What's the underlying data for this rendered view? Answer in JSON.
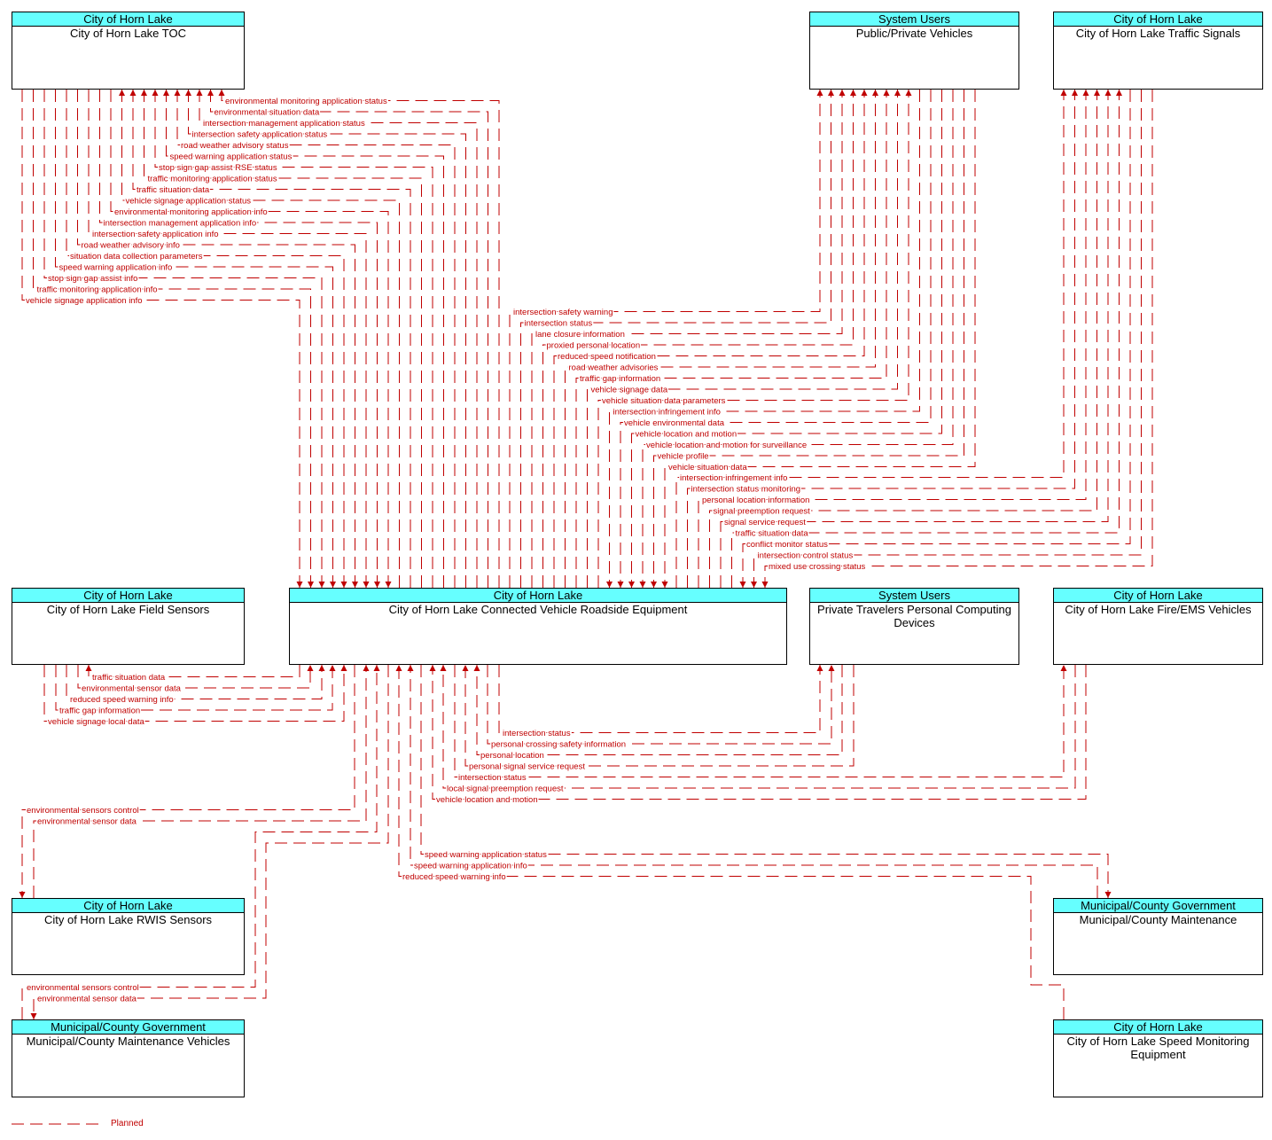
{
  "colors": {
    "flow": "#c00000",
    "header": "#66ffff",
    "border": "#000000"
  },
  "boxes": [
    {
      "id": "toc",
      "category": "City of Horn Lake",
      "name": "City of Horn Lake TOC"
    },
    {
      "id": "ppv",
      "category": "System Users",
      "name": "Public/Private Vehicles"
    },
    {
      "id": "ts",
      "category": "City of Horn Lake",
      "name": "City of Horn Lake Traffic Signals"
    },
    {
      "id": "fs",
      "category": "City of Horn Lake",
      "name": "City of Horn Lake Field Sensors"
    },
    {
      "id": "cvre",
      "category": "City of Horn Lake",
      "name": "City of Horn Lake Connected Vehicle Roadside Equipment"
    },
    {
      "id": "pd",
      "category": "System Users",
      "name": "Private Travelers Personal Computing Devices"
    },
    {
      "id": "fire",
      "category": "City of Horn Lake",
      "name": "City of Horn Lake Fire/EMS Vehicles"
    },
    {
      "id": "rwis",
      "category": "City of Horn Lake",
      "name": "City of Horn Lake RWIS Sensors"
    },
    {
      "id": "mcm",
      "category": "Municipal/County Government",
      "name": "Municipal/County Maintenance"
    },
    {
      "id": "mv",
      "category": "Municipal/County Government",
      "name": "Municipal/County Maintenance Vehicles"
    },
    {
      "id": "sme",
      "category": "City of Horn Lake",
      "name": "City of Horn Lake Speed Monitoring Equipment"
    }
  ],
  "flows": [
    {
      "label": "environmental monitoring application status",
      "from": "cvre",
      "to": "toc"
    },
    {
      "label": "environmental situation data",
      "from": "cvre",
      "to": "toc"
    },
    {
      "label": "intersection management application status",
      "from": "cvre",
      "to": "toc"
    },
    {
      "label": "intersection safety application status",
      "from": "cvre",
      "to": "toc"
    },
    {
      "label": "road weather advisory status",
      "from": "cvre",
      "to": "toc"
    },
    {
      "label": "speed warning application status",
      "from": "cvre",
      "to": "toc"
    },
    {
      "label": "stop sign gap assist RSE status",
      "from": "cvre",
      "to": "toc"
    },
    {
      "label": "traffic monitoring application status",
      "from": "cvre",
      "to": "toc"
    },
    {
      "label": "traffic situation data",
      "from": "cvre",
      "to": "toc"
    },
    {
      "label": "vehicle signage application status",
      "from": "cvre",
      "to": "toc"
    },
    {
      "label": "environmental monitoring application info",
      "from": "toc",
      "to": "cvre"
    },
    {
      "label": "intersection management application info",
      "from": "toc",
      "to": "cvre"
    },
    {
      "label": "intersection safety application info",
      "from": "toc",
      "to": "cvre"
    },
    {
      "label": "road weather advisory info",
      "from": "toc",
      "to": "cvre"
    },
    {
      "label": "situation data collection parameters",
      "from": "toc",
      "to": "cvre"
    },
    {
      "label": "speed warning application info",
      "from": "toc",
      "to": "cvre"
    },
    {
      "label": "stop sign gap assist info",
      "from": "toc",
      "to": "cvre"
    },
    {
      "label": "traffic monitoring application info",
      "from": "toc",
      "to": "cvre"
    },
    {
      "label": "vehicle signage application info",
      "from": "toc",
      "to": "cvre"
    },
    {
      "label": "intersection safety warning",
      "from": "cvre",
      "to": "ppv"
    },
    {
      "label": "intersection status",
      "from": "cvre",
      "to": "ppv"
    },
    {
      "label": "lane closure information",
      "from": "cvre",
      "to": "ppv"
    },
    {
      "label": "proxied personal location",
      "from": "cvre",
      "to": "ppv"
    },
    {
      "label": "reduced speed notification",
      "from": "cvre",
      "to": "ppv"
    },
    {
      "label": "road weather advisories",
      "from": "cvre",
      "to": "ppv"
    },
    {
      "label": "traffic gap information",
      "from": "cvre",
      "to": "ppv"
    },
    {
      "label": "vehicle signage data",
      "from": "cvre",
      "to": "ppv"
    },
    {
      "label": "vehicle situation data parameters",
      "from": "cvre",
      "to": "ppv"
    },
    {
      "label": "intersection infringement info",
      "from": "ppv",
      "to": "cvre"
    },
    {
      "label": "vehicle environmental data",
      "from": "ppv",
      "to": "cvre"
    },
    {
      "label": "vehicle location and motion",
      "from": "ppv",
      "to": "cvre"
    },
    {
      "label": "vehicle location and motion for surveillance",
      "from": "ppv",
      "to": "cvre"
    },
    {
      "label": "vehicle profile",
      "from": "ppv",
      "to": "cvre"
    },
    {
      "label": "vehicle situation data",
      "from": "ppv",
      "to": "cvre"
    },
    {
      "label": "intersection infringement info",
      "from": "cvre",
      "to": "ts"
    },
    {
      "label": "intersection status monitoring",
      "from": "cvre",
      "to": "ts"
    },
    {
      "label": "personal location information",
      "from": "cvre",
      "to": "ts"
    },
    {
      "label": "signal preemption request",
      "from": "cvre",
      "to": "ts"
    },
    {
      "label": "signal service request",
      "from": "cvre",
      "to": "ts"
    },
    {
      "label": "traffic situation data",
      "from": "cvre",
      "to": "ts"
    },
    {
      "label": "conflict monitor status",
      "from": "ts",
      "to": "cvre"
    },
    {
      "label": "intersection control status",
      "from": "ts",
      "to": "cvre"
    },
    {
      "label": "mixed use crossing status",
      "from": "ts",
      "to": "cvre"
    },
    {
      "label": "traffic situation data",
      "from": "cvre",
      "to": "fs"
    },
    {
      "label": "environmental sensor data",
      "from": "fs",
      "to": "cvre"
    },
    {
      "label": "reduced speed warning info",
      "from": "fs",
      "to": "cvre"
    },
    {
      "label": "traffic gap information",
      "from": "fs",
      "to": "cvre"
    },
    {
      "label": "vehicle signage local data",
      "from": "fs",
      "to": "cvre"
    },
    {
      "label": "intersection status",
      "from": "cvre",
      "to": "pd"
    },
    {
      "label": "personal crossing safety information",
      "from": "cvre",
      "to": "pd"
    },
    {
      "label": "personal location",
      "from": "pd",
      "to": "cvre"
    },
    {
      "label": "personal signal service request",
      "from": "pd",
      "to": "cvre"
    },
    {
      "label": "intersection status",
      "from": "cvre",
      "to": "fire"
    },
    {
      "label": "local signal preemption request",
      "from": "fire",
      "to": "cvre"
    },
    {
      "label": "vehicle location and motion",
      "from": "fire",
      "to": "cvre"
    },
    {
      "label": "environmental sensors control",
      "from": "cvre",
      "to": "rwis"
    },
    {
      "label": "environmental sensor data",
      "from": "rwis",
      "to": "cvre"
    },
    {
      "label": "environmental sensors control",
      "from": "mv",
      "to": "cvre"
    },
    {
      "label": "environmental sensor data",
      "from": "cvre",
      "to": "mv"
    },
    {
      "label": "speed warning application status",
      "from": "cvre",
      "to": "mcm"
    },
    {
      "label": "speed warning application info",
      "from": "mcm",
      "to": "cvre"
    },
    {
      "label": "reduced speed warning info",
      "from": "sme",
      "to": "cvre"
    }
  ],
  "legend": {
    "label": "Planned",
    "status": "planned"
  }
}
